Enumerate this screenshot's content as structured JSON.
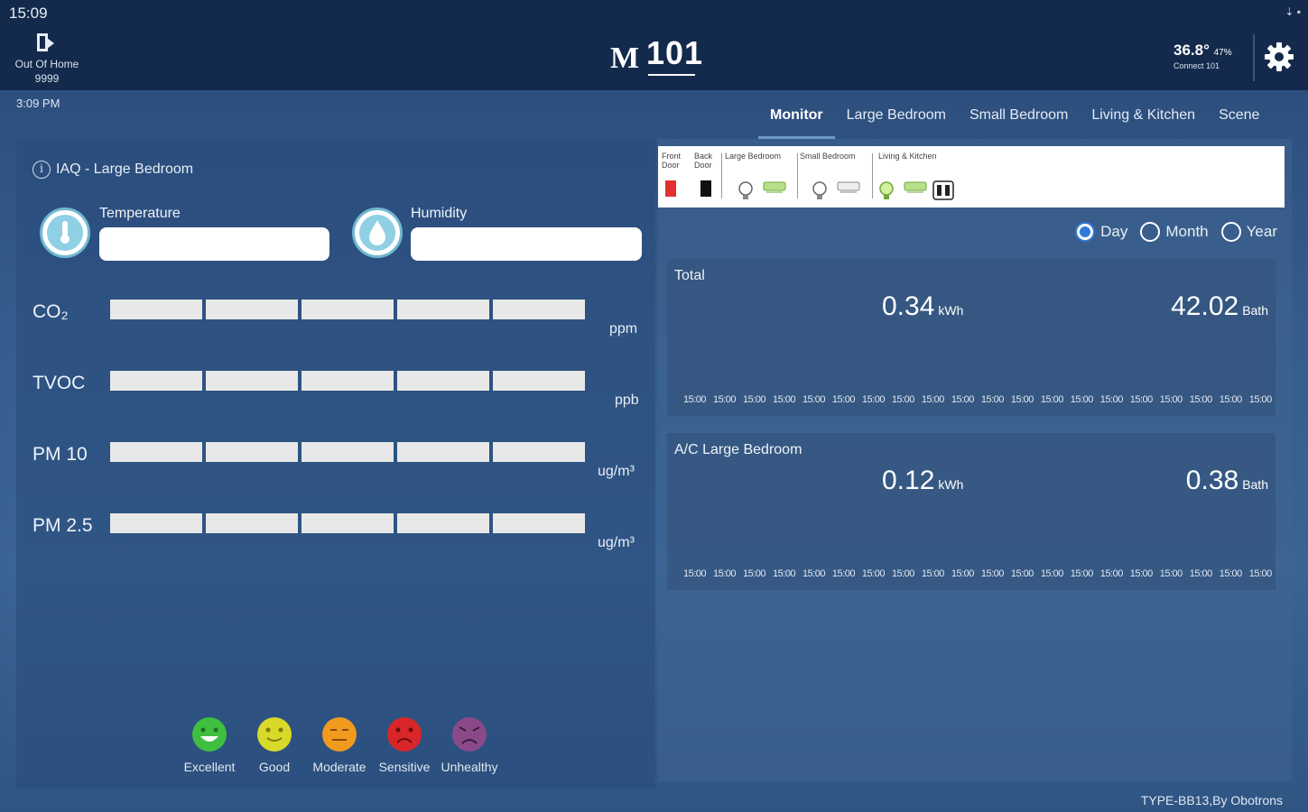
{
  "status_bar": {
    "time": "15:09",
    "icons": "⇣ ▪"
  },
  "header": {
    "home_status_line1": "Out Of Home",
    "home_status_line2": "9999",
    "logo_text": "M",
    "logo_number": "101",
    "weather_temp": "36.8°",
    "weather_humidity": "47%",
    "weather_sub": "Connect 101",
    "time_label": "3:09 PM"
  },
  "tabs": [
    {
      "label": "Monitor",
      "active": true
    },
    {
      "label": "Large Bedroom"
    },
    {
      "label": "Small Bedroom"
    },
    {
      "label": "Living & Kitchen"
    },
    {
      "label": "Scene"
    }
  ],
  "iaq": {
    "title": "IAQ - Large Bedroom",
    "temperature_label": "Temperature",
    "temperature_value": "",
    "humidity_label": "Humidity",
    "humidity_value": "",
    "meters": [
      {
        "label": "CO₂",
        "unit": "ppm"
      },
      {
        "label": "TVOC",
        "unit": "ppb"
      },
      {
        "label": "PM 10",
        "unit": "ug/m³"
      },
      {
        "label": "PM 2.5",
        "unit": "ug/m³"
      }
    ],
    "legend": [
      {
        "label": "Excellent",
        "color": "#3fbf3f"
      },
      {
        "label": "Good",
        "color": "#d9d92a"
      },
      {
        "label": "Moderate",
        "color": "#f09a1e"
      },
      {
        "label": "Sensitive",
        "color": "#d9262a"
      },
      {
        "label": "Unhealthy",
        "color": "#8a4a8a"
      }
    ]
  },
  "devices": {
    "groups": [
      "Front Door",
      "Back Door",
      "Large Bedroom",
      "Small Bedroom",
      "Living & Kitchen"
    ]
  },
  "period": {
    "options": [
      "Day",
      "Month",
      "Year"
    ],
    "selected": "Day"
  },
  "energy": {
    "cards": [
      {
        "title": "Total",
        "kwh": "0.34",
        "kwh_unit": "kWh",
        "bath": "42.02",
        "bath_unit": "Bath"
      },
      {
        "title": "A/C Large Bedroom",
        "kwh": "0.12",
        "kwh_unit": "kWh",
        "bath": "0.38",
        "bath_unit": "Bath"
      }
    ],
    "axis_ticks": [
      "15:00",
      "15:00",
      "15:00",
      "15:00",
      "15:00",
      "15:00",
      "15:00",
      "15:00",
      "15:00",
      "15:00",
      "15:00",
      "15:00",
      "15:00",
      "15:00",
      "15:00",
      "15:00",
      "15:00",
      "15:00",
      "15:00",
      "15:00"
    ]
  },
  "footer": "TYPE-BB13,By Obotrons",
  "colors": {
    "header_bg": "#142a4c",
    "accent": "#2f7ad9"
  }
}
